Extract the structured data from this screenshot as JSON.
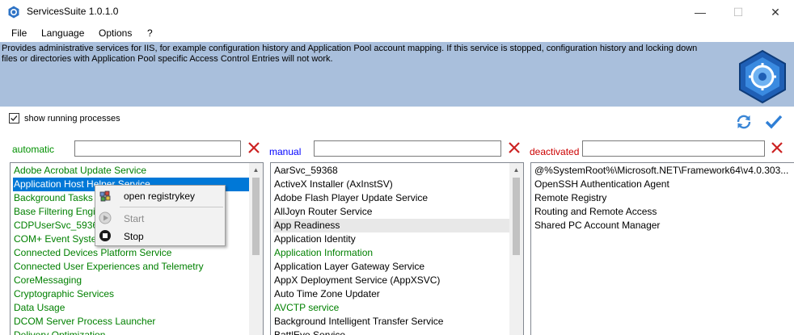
{
  "app": {
    "title": "ServicesSuite 1.0.1.0"
  },
  "window_controls": {
    "minimize": "—",
    "maximize": "☐",
    "close": "✕"
  },
  "menu": [
    "File",
    "Language",
    "Options",
    "?"
  ],
  "banner": {
    "text": "Provides administrative services for IIS, for example configuration history and Application Pool account mapping. If this service is stopped, configuration history and locking down files or directories with Application Pool specific Access Control Entries will not work."
  },
  "options": {
    "show_running_label": "show running processes",
    "show_running_checked": true
  },
  "toolbar": {
    "refresh_icon": "refresh-icon",
    "apply_icon": "checkmark-icon"
  },
  "colors": {
    "automatic": "#009000",
    "manual": "#0000ff",
    "deactivated": "#cc0000",
    "running_item": "#008000",
    "banner": "#a9bfdc",
    "selection": "#0078d7",
    "clear_x": "#cc2222"
  },
  "columns": {
    "automatic": {
      "label": "automatic",
      "filter_value": "",
      "items": [
        {
          "text": "Adobe Acrobat Update Service",
          "running": true
        },
        {
          "text": "Application Host Helper Service",
          "running": true,
          "selected": true
        },
        {
          "text": "Background Tasks Infrastructure Service",
          "running": true
        },
        {
          "text": "Base Filtering Engine",
          "running": true
        },
        {
          "text": "CDPUserSvc_59368",
          "running": true
        },
        {
          "text": "COM+ Event System",
          "running": true
        },
        {
          "text": "Connected Devices Platform Service",
          "running": true
        },
        {
          "text": "Connected User Experiences and Telemetry",
          "running": true
        },
        {
          "text": "CoreMessaging",
          "running": true
        },
        {
          "text": "Cryptographic Services",
          "running": true
        },
        {
          "text": "Data Usage",
          "running": true
        },
        {
          "text": "DCOM Server Process Launcher",
          "running": true
        },
        {
          "text": "Delivery Optimization",
          "running": true
        }
      ]
    },
    "manual": {
      "label": "manual",
      "filter_value": "",
      "items": [
        {
          "text": "AarSvc_59368",
          "running": false
        },
        {
          "text": "ActiveX Installer (AxInstSV)",
          "running": false
        },
        {
          "text": "Adobe Flash Player Update Service",
          "running": false
        },
        {
          "text": "AllJoyn Router Service",
          "running": false
        },
        {
          "text": "App Readiness",
          "running": false,
          "hover": true
        },
        {
          "text": "Application Identity",
          "running": false
        },
        {
          "text": "Application Information",
          "running": true
        },
        {
          "text": "Application Layer Gateway Service",
          "running": false
        },
        {
          "text": "AppX Deployment Service (AppXSVC)",
          "running": false
        },
        {
          "text": "Auto Time Zone Updater",
          "running": false
        },
        {
          "text": "AVCTP service",
          "running": true
        },
        {
          "text": "Background Intelligent Transfer Service",
          "running": false
        },
        {
          "text": "BattlEye Service",
          "running": false
        }
      ]
    },
    "deactivated": {
      "label": "deactivated",
      "filter_value": "",
      "items": [
        {
          "text": "@%SystemRoot%\\Microsoft.NET\\Framework64\\v4.0.303...",
          "running": false
        },
        {
          "text": "OpenSSH Authentication Agent",
          "running": false
        },
        {
          "text": "Remote Registry",
          "running": false
        },
        {
          "text": "Routing and Remote Access",
          "running": false
        },
        {
          "text": "Shared PC Account Manager",
          "running": false
        }
      ]
    }
  },
  "context_menu": {
    "items": [
      {
        "label": "open registrykey",
        "icon": "registry-icon",
        "enabled": true
      },
      {
        "label": "Start",
        "icon": "play-icon",
        "enabled": false
      },
      {
        "label": "Stop",
        "icon": "stop-icon",
        "enabled": true
      }
    ]
  }
}
